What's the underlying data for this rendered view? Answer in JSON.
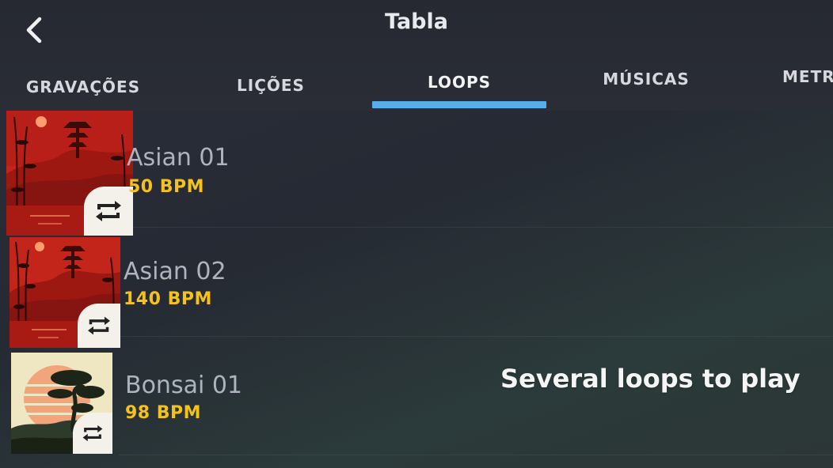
{
  "header": {
    "title": "Tabla",
    "back_icon": "chevron-left-icon"
  },
  "tabs": [
    {
      "label": "GRAVAÇÕES",
      "active": false
    },
    {
      "label": "LIÇÕES",
      "active": false
    },
    {
      "label": "LOOPS",
      "active": true
    },
    {
      "label": "MÚSICAS",
      "active": false
    },
    {
      "label": "METRO",
      "active": false
    }
  ],
  "colors": {
    "accent": "#58aee8",
    "bpm": "#f5c21a",
    "background": "#262a33"
  },
  "loops": [
    {
      "name": "Asian 01",
      "bpm": "50 BPM",
      "artwork": "red-pagoda-art",
      "badge_icon": "loop-icon"
    },
    {
      "name": "Asian 02",
      "bpm": "140 BPM",
      "artwork": "red-pagoda-art",
      "badge_icon": "loop-icon"
    },
    {
      "name": "Bonsai 01",
      "bpm": "98 BPM",
      "artwork": "bonsai-sunset-art",
      "badge_icon": "loop-icon"
    }
  ],
  "caption": "Several loops to play"
}
